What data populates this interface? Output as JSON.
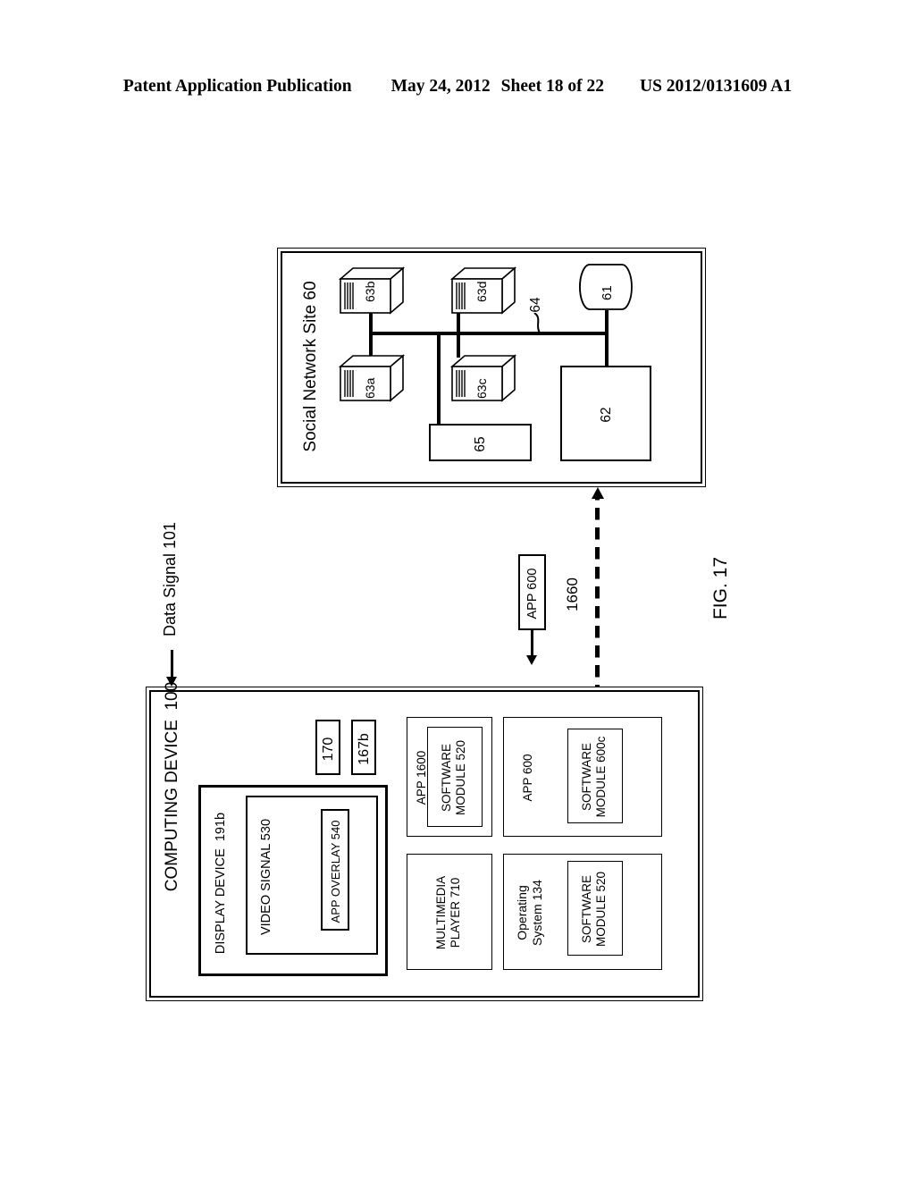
{
  "header": {
    "publication": "Patent Application Publication",
    "date": "May 24, 2012",
    "sheet": "Sheet 18 of 22",
    "number": "US 2012/0131609 A1"
  },
  "figure": {
    "label": "FIG. 17"
  },
  "social_network_site": {
    "title": "Social Network Site 60",
    "servers": [
      {
        "id": "63b",
        "label": "63b"
      },
      {
        "id": "63a",
        "label": "63a"
      },
      {
        "id": "63d",
        "label": "63d"
      },
      {
        "id": "63c",
        "label": "63c"
      }
    ],
    "database": {
      "label": "61"
    },
    "bus_label": "64",
    "box_65": "65",
    "box_62": "62"
  },
  "data_signal": {
    "label": "Data Signal 101"
  },
  "middle": {
    "app_600_label": "APP 600",
    "link_label": "1660"
  },
  "computing_device": {
    "title": "COMPUTING DEVICE  100",
    "small_boxes": [
      {
        "label": "170"
      },
      {
        "label": "167b"
      }
    ],
    "display_device": {
      "title": "DISPLAY DEVICE  191b",
      "video_signal": {
        "title": "VIDEO SIGNAL 530",
        "app_overlay": {
          "title": "APP OVERLAY 540"
        }
      }
    },
    "app_1600": {
      "title": "APP 1600",
      "software_module": "SOFTWARE\nMODULE 520"
    },
    "multimedia_player": {
      "title": "MULTIMEDIA\nPLAYER 710"
    },
    "app_600": {
      "title": "APP 600",
      "software_module": "SOFTWARE\nMODULE 600c"
    },
    "operating_system": {
      "title": "Operating\nSystem 134",
      "software_module": "SOFTWARE\nMODULE 520"
    }
  }
}
